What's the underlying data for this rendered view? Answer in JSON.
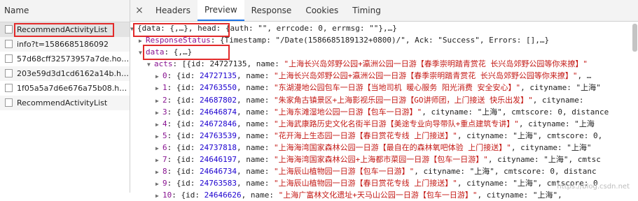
{
  "left": {
    "header": "Name",
    "requests": [
      {
        "name": "RecommendActivityList",
        "selected": true
      },
      {
        "name": "info?t=1586685186092",
        "selected": false
      },
      {
        "name": "57d68cff32573957a7de.hot-...",
        "selected": false
      },
      {
        "name": "203e59d3d1cd6162a14b.hot-...",
        "selected": false
      },
      {
        "name": "1f05a5a7d6e676a75b08.hot-...",
        "selected": false
      },
      {
        "name": "RecommendActivityList",
        "selected": false
      }
    ]
  },
  "tabs": {
    "close": "×",
    "items": [
      "Headers",
      "Preview",
      "Response",
      "Cookies",
      "Timing"
    ],
    "active": "Preview"
  },
  "preview": {
    "root": "{data: {,…}, head: {auth: \"\", errcode: 0, errmsg: \"\"},…}",
    "response_status_key": "ResponseStatus",
    "response_status_val": ": {Timestamp: \"/Date(1586685189132+0800)/\", Ack: \"Success\", Errors: [],…}",
    "data_key": "data",
    "data_val": ": {,…}",
    "acts_key": "acts",
    "acts_prefix": ": [{id: 24727135, name: ",
    "acts_name": "\"上海长兴岛郊野公园+瀛洲公园一日游【春季崇明踏青赏花 长兴岛郊野公园等你来撩】\"",
    "rows": [
      {
        "idx": "0",
        "id": "24727135",
        "name": "\"上海长兴岛郊野公园+瀛洲公园一日游【春季崇明踏青赏花 长兴岛郊野公园等你来撩】\"",
        "rest": ", …"
      },
      {
        "idx": "1",
        "id": "24763550",
        "name": "\"东湖漫地公园包车一日游【当地司机 暖心服务 阳光消费 安全安心】\"",
        "rest": ", cityname: \"上海\""
      },
      {
        "idx": "2",
        "id": "24687802",
        "name": "\"朱家角古镇景区+上海影视乐园一日游【GO讲师团，上门接送 快乐出发】\"",
        "rest": ", cityname:"
      },
      {
        "idx": "3",
        "id": "24646874",
        "name": "\"上海东滩湿地公园一日游【包车一日游】\"",
        "rest": ", cityname: \"上海\", cmtscore: 0, distance"
      },
      {
        "idx": "4",
        "id": "24672846",
        "name": "\"上海武康路历史文化名街半日游【美途专业向导带队+重点建筑专讲】\"",
        "rest": ", cityname: \"上海"
      },
      {
        "idx": "5",
        "id": "24763539",
        "name": "\"花开海上生态园一日游【春日赏花专线 上门接送】\"",
        "rest": ", cityname: \"上海\", cmtscore: 0,"
      },
      {
        "idx": "6",
        "id": "24737818",
        "name": "\"上海海湾国家森林公园一日游【最自在的森林氧吧体验 上门接送】\"",
        "rest": ", cityname: \"上海\""
      },
      {
        "idx": "7",
        "id": "24646197",
        "name": "\"上海海湾国家森林公园+上海都市菜园一日游【包车一日游】\"",
        "rest": ", cityname: \"上海\", cmtsc"
      },
      {
        "idx": "8",
        "id": "24646734",
        "name": "\"上海辰山植物园一日游【包车一日游】\"",
        "rest": ", cityname: \"上海\", cmtscore: 0, distanc"
      },
      {
        "idx": "9",
        "id": "24763583",
        "name": "\"上海辰山植物园一日游【春日赏花专线 上门接送】\"",
        "rest": ", cityname: \"上海\", cmtscore: 0"
      },
      {
        "idx": "10",
        "id": "24646626",
        "name": "\"上海广富林文化遗址+天马山公园一日游【包车一日游】\"",
        "rest": ", cityname: \"上海\","
      }
    ]
  },
  "watermark": "https://blog.csdn.net"
}
